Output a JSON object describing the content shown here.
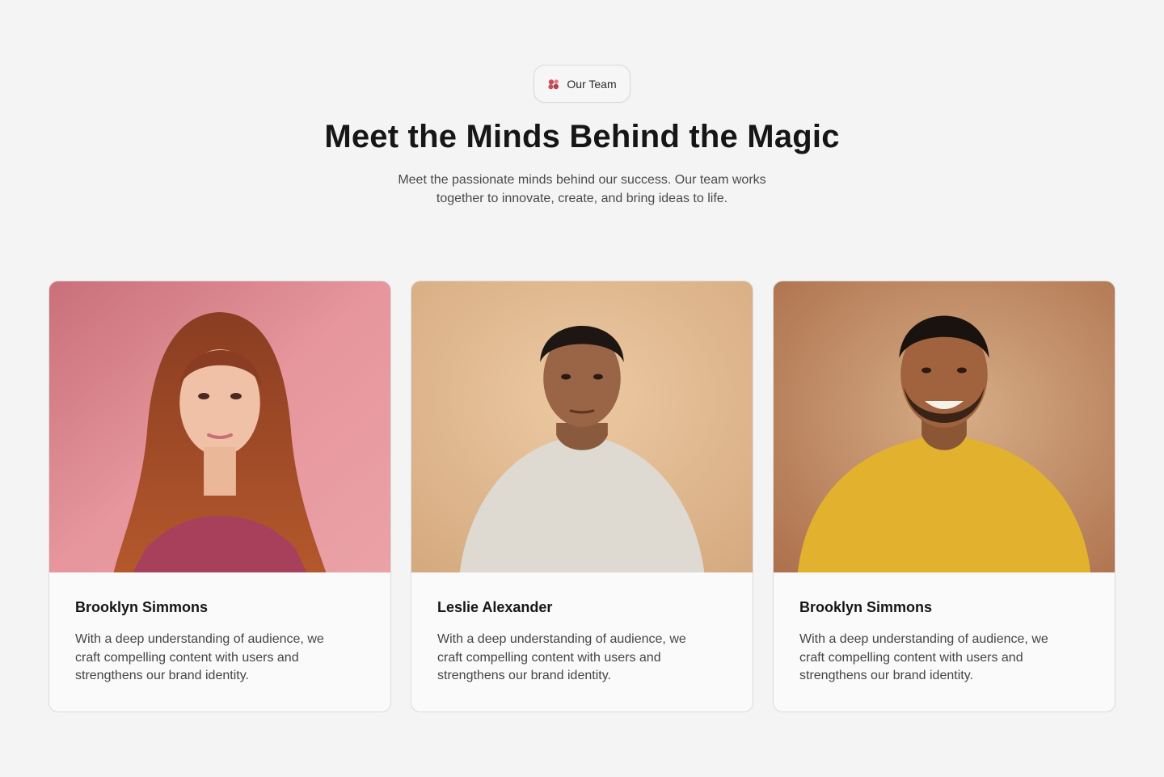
{
  "badge": {
    "icon": "team-blobs-icon",
    "label": "Our Team",
    "accent": "#c8505e"
  },
  "title": "Meet the Minds Behind the Magic",
  "subtitle": "Meet the passionate minds behind our success. Our team works together to innovate, create, and bring ideas to life.",
  "team": [
    {
      "photo": "portrait of woman with long auburn hair on pink background",
      "name": "Brooklyn Simmons",
      "bio": "With a deep understanding of audience, we craft compelling content with users and strengthens our brand identity."
    },
    {
      "photo": "portrait of young man in white t-shirt on beige background",
      "name": "Leslie Alexander",
      "bio": "With a deep understanding of audience, we craft compelling content with users and strengthens our brand identity."
    },
    {
      "photo": "portrait of smiling man in yellow t-shirt on tan background",
      "name": "Brooklyn Simmons",
      "bio": "With a deep understanding of audience, we craft compelling content with users and strengthens our brand identity."
    }
  ]
}
